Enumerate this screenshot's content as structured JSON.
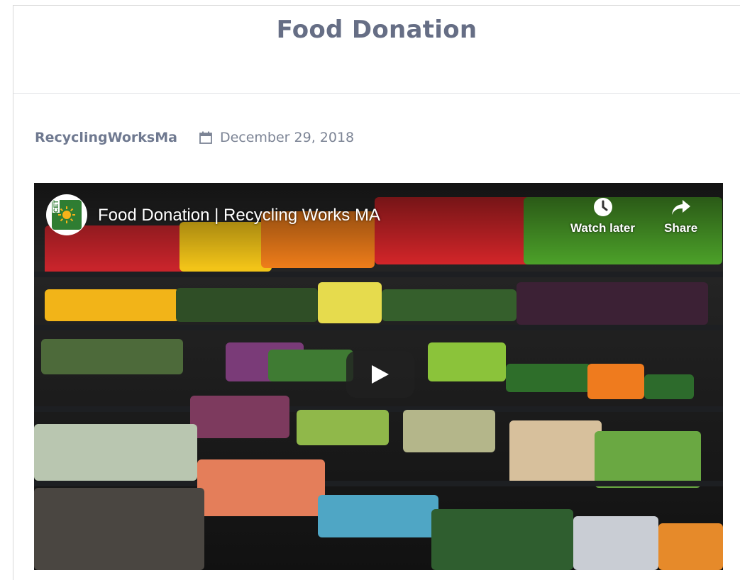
{
  "page": {
    "title": "Food Donation"
  },
  "meta": {
    "author": "RecyclingWorksMa",
    "date": "December 29, 2018",
    "date_icon": "calendar-icon"
  },
  "video": {
    "title": "Food Donation | Recycling Works MA",
    "channel_logo_text": "CET",
    "watch_later_label": "Watch later",
    "share_label": "Share",
    "watch_later_icon": "clock-icon",
    "share_icon": "share-arrow-icon",
    "play_icon": "play-icon"
  },
  "colors": {
    "title": "#666e85",
    "author": "#6f7990",
    "date": "#7c8495",
    "divider": "#e3e4e8"
  }
}
